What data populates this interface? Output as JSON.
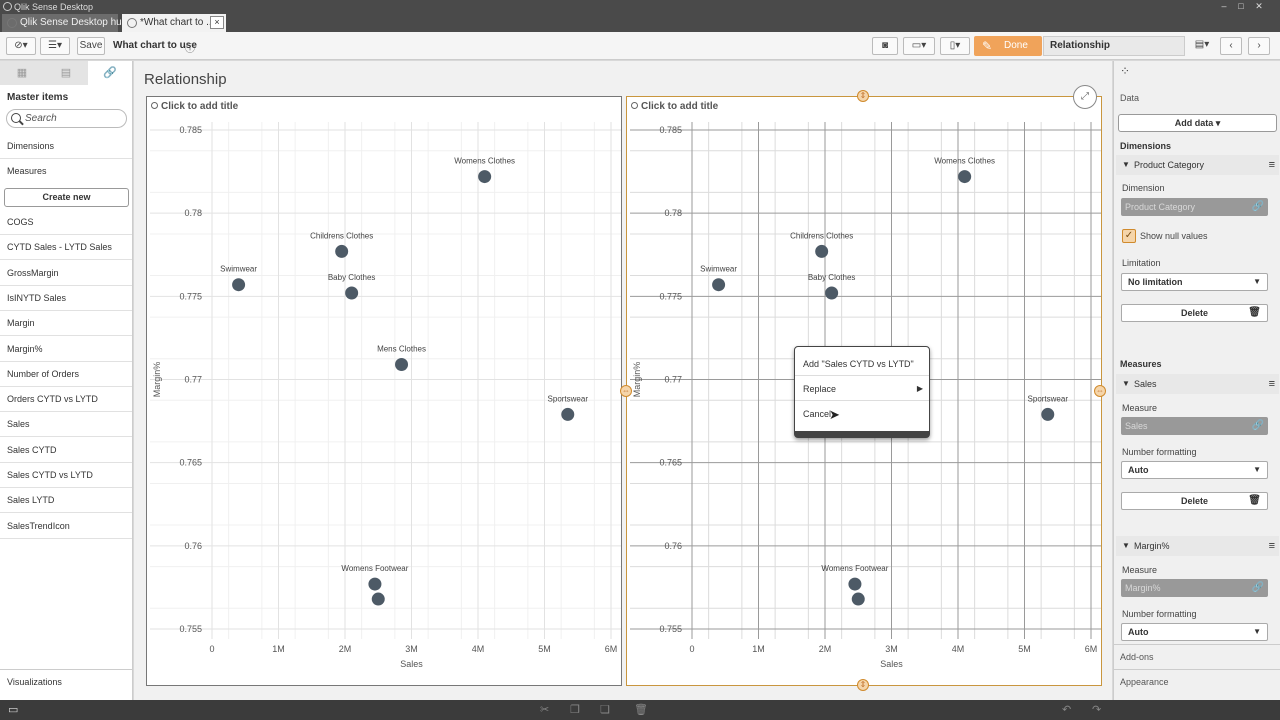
{
  "window": {
    "title": "Qlik Sense Desktop",
    "tabs": [
      {
        "label": "Qlik Sense Desktop hub"
      },
      {
        "label": "*What chart to ..."
      }
    ],
    "close_glyph": "×"
  },
  "toolbar": {
    "save_label": "Save",
    "app_name": "What chart to use",
    "done_label": "Done",
    "sheet_name": "Relationship"
  },
  "sheet": {
    "title": "Relationship"
  },
  "left_panel": {
    "header": "Master items",
    "search_placeholder": "Search",
    "sections": [
      "Dimensions",
      "Measures"
    ],
    "create_label": "Create new",
    "items": [
      "COGS",
      "CYTD Sales - LYTD Sales",
      "GrossMargin",
      "IsINYTD Sales",
      "Margin",
      "Margin%",
      "Number of Orders",
      "Orders CYTD vs LYTD",
      "Sales",
      "Sales CYTD",
      "Sales CYTD vs LYTD",
      "Sales LYTD",
      "SalesTrendIcon"
    ],
    "footer": "Visualizations"
  },
  "charts": [
    {
      "title": "Click to add title"
    },
    {
      "title": "Click to add title"
    }
  ],
  "chart_data": [
    {
      "type": "scatter",
      "title": "Click to add title",
      "xlabel": "Sales",
      "ylabel": "Margin%",
      "xlim": [
        0,
        6000000
      ],
      "ylim": [
        0.755,
        0.785
      ],
      "x_ticks": [
        "0",
        "1M",
        "2M",
        "3M",
        "4M",
        "5M",
        "6M"
      ],
      "y_ticks": [
        "0.755",
        "0.76",
        "0.765",
        "0.77",
        "0.775",
        "0.78",
        "0.785"
      ],
      "point_color": "#4d5a66",
      "points": [
        {
          "label": "Womens Clothes",
          "x": 4100000,
          "y": 0.7822
        },
        {
          "label": "Childrens Clothes",
          "x": 1950000,
          "y": 0.7777
        },
        {
          "label": "Swimwear",
          "x": 400000,
          "y": 0.7757
        },
        {
          "label": "Baby Clothes",
          "x": 2100000,
          "y": 0.7752
        },
        {
          "label": "Mens Clothes",
          "x": 2850000,
          "y": 0.7709
        },
        {
          "label": "Sportswear",
          "x": 5350000,
          "y": 0.7679
        },
        {
          "label": "Womens Footwear",
          "x": 2450000,
          "y": 0.7577
        },
        {
          "label": "",
          "x": 2500000,
          "y": 0.7568
        }
      ]
    },
    {
      "type": "scatter",
      "title": "Click to add title",
      "xlabel": "Sales",
      "ylabel": "Margin%",
      "xlim": [
        0,
        6000000
      ],
      "ylim": [
        0.755,
        0.785
      ],
      "x_ticks": [
        "0",
        "1M",
        "2M",
        "3M",
        "4M",
        "5M",
        "6M"
      ],
      "y_ticks": [
        "0.755",
        "0.76",
        "0.765",
        "0.77",
        "0.775",
        "0.78",
        "0.785"
      ],
      "point_color": "#4d5a66",
      "points": [
        {
          "label": "Womens Clothes",
          "x": 4100000,
          "y": 0.7822
        },
        {
          "label": "Childrens Clothes",
          "x": 1950000,
          "y": 0.7777
        },
        {
          "label": "Swimwear",
          "x": 400000,
          "y": 0.7757
        },
        {
          "label": "Baby Clothes",
          "x": 2100000,
          "y": 0.7752
        },
        {
          "label": "Sportswear",
          "x": 5350000,
          "y": 0.7679
        },
        {
          "label": "Womens Footwear",
          "x": 2450000,
          "y": 0.7577
        },
        {
          "label": "",
          "x": 2500000,
          "y": 0.7568
        }
      ]
    }
  ],
  "context_menu": {
    "items": [
      "Add \"Sales CYTD vs LYTD\"",
      "Replace",
      "Cancel"
    ]
  },
  "right_panel": {
    "section": "Data",
    "add_data_label": "Add data",
    "dimensions_header": "Dimensions",
    "dimension": {
      "name": "Product Category",
      "field_label": "Dimension",
      "field_value": "Product Category",
      "show_null_label": "Show null values",
      "limitation_label": "Limitation",
      "limitation_value": "No limitation",
      "delete_label": "Delete"
    },
    "measures_header": "Measures",
    "measures": [
      {
        "name": "Sales",
        "field_label": "Measure",
        "field_value": "Sales",
        "format_label": "Number formatting",
        "format_value": "Auto",
        "delete_label": "Delete"
      },
      {
        "name": "Margin%",
        "field_label": "Measure",
        "field_value": "Margin%",
        "format_label": "Number formatting",
        "format_value": "Auto"
      }
    ],
    "footer": [
      "Add-ons",
      "Appearance"
    ]
  },
  "colors": {
    "accent": "#f0a35a",
    "point": "#4d5a66",
    "selection_border": "#c9963e"
  }
}
